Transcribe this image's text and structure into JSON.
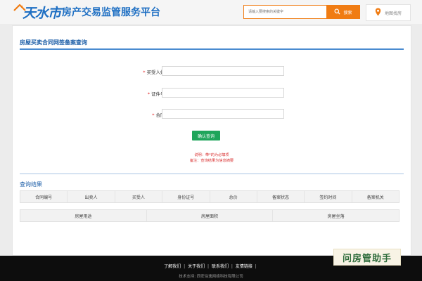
{
  "header": {
    "logo_main": "天水市",
    "logo_sub": "房产交易监管服务平台",
    "search_placeholder": "请输入要搜索的关键字",
    "search_button": "搜索",
    "map_button": "地图找房"
  },
  "main": {
    "page_title": "房屋买卖合同网签备案查询",
    "form": {
      "buyer_label": "买受人姓名",
      "id_label": "证件号码",
      "contract_label": "合同号",
      "required_mark": "*",
      "confirm_button": "确认查询"
    },
    "notes": {
      "line1": "说明：带*的为必填项",
      "line2": "备注：查询结果为信息摘要"
    },
    "results": {
      "title": "查询结果",
      "table1_headers": [
        "合同编号",
        "出卖人",
        "买受人",
        "身份证号",
        "总价",
        "备案状态",
        "签约时间",
        "备案机关"
      ],
      "table2_headers": [
        "房屋用途",
        "房屋面积",
        "房屋坐落"
      ]
    }
  },
  "footer": {
    "links": [
      "了解我们",
      "关于我们",
      "联系我们",
      "友情链接"
    ],
    "separator": "|",
    "tech_support": "技术支持: 西安泊逸网络科技有限公司"
  },
  "watermark": "问房管助手",
  "colors": {
    "brand_blue": "#1e6fc3",
    "accent_orange": "#f07c13",
    "confirm_green": "#1fa55a",
    "required_red": "#e02020",
    "footer_bg": "#0d0d0d"
  }
}
